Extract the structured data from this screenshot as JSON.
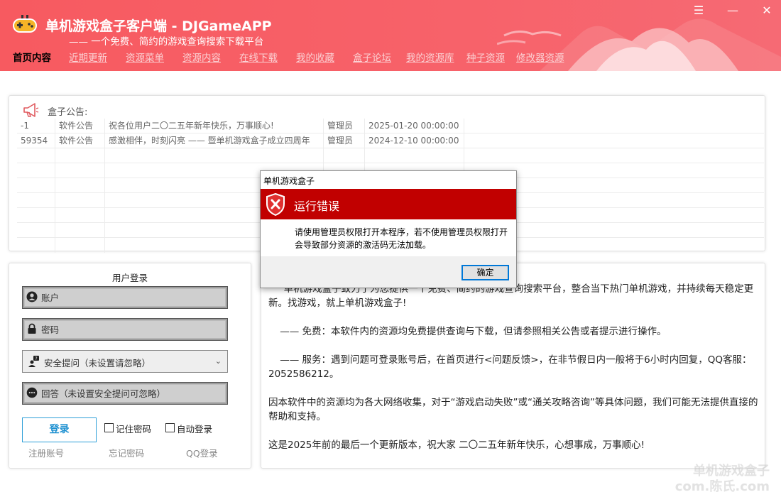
{
  "header": {
    "title": "单机游戏盒子客户端 - DJGameAPP",
    "subtitle": "—— 一个免费、简约的游戏查询搜索下载平台",
    "colors": {
      "brand": "#f75a60",
      "nav_inactive": "#fbd0d3"
    },
    "window_controls": {
      "menu": "☰",
      "minimize": "—",
      "close": "✕"
    }
  },
  "nav": {
    "items": [
      "首页内容",
      "近期更新",
      "资源菜单",
      "资源内容",
      "在线下载",
      "我的收藏",
      "盒子论坛",
      "我的资源库",
      "种子资源",
      "修改器资源"
    ],
    "active": "首页内容"
  },
  "announcements": {
    "label": "盒子公告:",
    "rows": [
      {
        "id": "-1",
        "type": "软件公告",
        "message": "祝各位用户二〇二五年新年快乐，万事顺心!",
        "author": "管理员",
        "time": "2025-01-20 00:00:00"
      },
      {
        "id": "59354",
        "type": "软件公告",
        "message": "感激相伴，时刻闪亮 —— 暨单机游戏盒子成立四周年",
        "author": "管理员",
        "time": "2024-12-10 00:00:00"
      }
    ]
  },
  "login": {
    "title": "用户登录",
    "account_placeholder": "账户",
    "password_placeholder": "密码",
    "security_question": "安全提问（未设置请忽略）",
    "answer_placeholder": "回答（未设置安全提问可忽略）",
    "login_button": "登录",
    "remember_password": "记住密码",
    "auto_login": "自动登录",
    "register_link": "注册账号",
    "forgot_link": "忘记密码",
    "qq_link": "QQ登录"
  },
  "info": {
    "intro": "单机游戏盒子致力于为您提供一个免费、简约的游戏查询搜索平台，整合当下热门单机游戏，并持续每天稳定更新。找游戏，就上单机游戏盒子!",
    "free": "—— 免费：本软件内的资源均免费提供查询与下载，但请参照相关公告或者提示进行操作。",
    "service": "—— 服务：遇到问题可登录账号后，在首页进行<问题反馈>，在非节假日内一般将于6小时内回复，QQ客服：2052586212。",
    "disclaimer": "因本软件中的资源均为各大网络收集，对于“游戏启动失败”或“通关攻略咨询”等具体问题，我们可能无法提供直接的帮助和支持。",
    "newyear": "这是2025年前的最后一个更新版本，祝大家 二〇二五年新年快乐，心想事成，万事顺心!"
  },
  "dialog": {
    "window_title": "单机游戏盒子",
    "heading": "运行错误",
    "message": "请使用管理员权限打开本程序，若不使用管理员权限打开会导致部分资源的激活码无法加载。",
    "ok_button": "确定",
    "banner_color": "#c10000"
  },
  "watermark": {
    "line1": "单机游戏盒子",
    "line2": "com.陈氏.com"
  }
}
